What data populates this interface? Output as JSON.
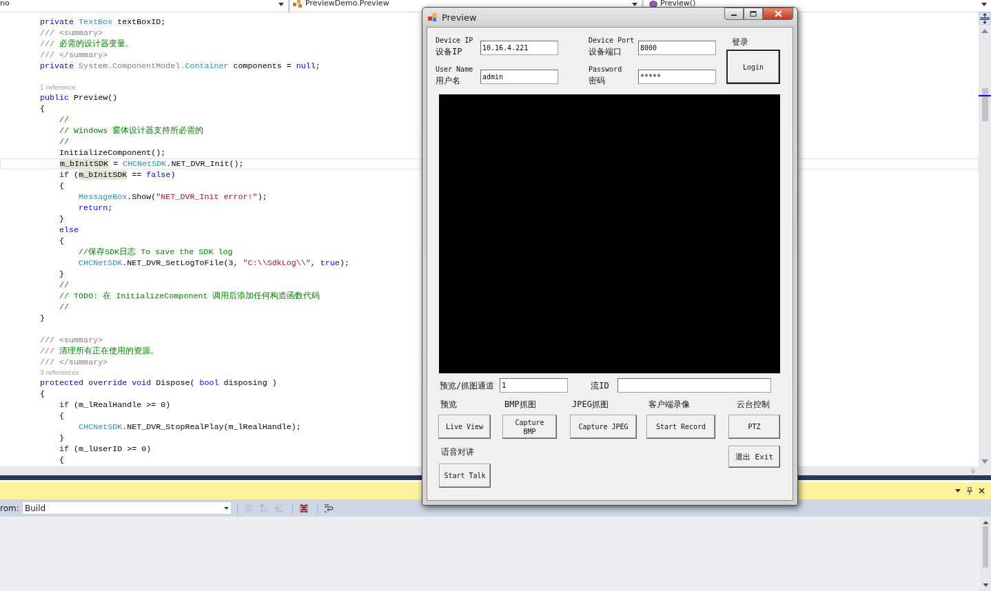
{
  "editor": {
    "nav": [
      "no",
      "PreviewDemo.Preview",
      "Preview()"
    ],
    "lines": [
      {
        "kind": "code",
        "current": false,
        "tokens": [
          {
            "kind": "keyword",
            "text": "private "
          },
          {
            "kind": "type",
            "text": "TextBox"
          },
          {
            "kind": "plain",
            "text": " textBoxID;"
          }
        ]
      },
      {
        "kind": "code",
        "current": false,
        "tokens": [
          {
            "kind": "doc",
            "text": "/// <summary>"
          }
        ]
      },
      {
        "kind": "code",
        "current": false,
        "tokens": [
          {
            "kind": "doc",
            "text": "/// "
          },
          {
            "kind": "comment",
            "text": "必需的设计器变量。"
          }
        ]
      },
      {
        "kind": "code",
        "current": false,
        "tokens": [
          {
            "kind": "doc",
            "text": "/// </summary>"
          }
        ]
      },
      {
        "kind": "code",
        "current": false,
        "tokens": [
          {
            "kind": "keyword",
            "text": "private "
          },
          {
            "kind": "doc",
            "text": "System.ComponentModel."
          },
          {
            "kind": "type",
            "text": "Container"
          },
          {
            "kind": "plain",
            "text": " components = "
          },
          {
            "kind": "keyword",
            "text": "null"
          },
          {
            "kind": "plain",
            "text": ";"
          }
        ]
      },
      {
        "kind": "blank"
      },
      {
        "kind": "lens",
        "text": "1 reference"
      },
      {
        "kind": "code",
        "current": false,
        "tokens": [
          {
            "kind": "keyword",
            "text": "public "
          },
          {
            "kind": "plain",
            "text": "Preview()"
          }
        ]
      },
      {
        "kind": "code",
        "current": false,
        "tokens": [
          {
            "kind": "plain",
            "text": "{"
          }
        ]
      },
      {
        "kind": "code",
        "current": false,
        "tokens": [
          {
            "kind": "comment",
            "text": "    //"
          }
        ]
      },
      {
        "kind": "code",
        "current": false,
        "tokens": [
          {
            "kind": "comment",
            "text": "    // Windows 窗体设计器支持所必需的"
          }
        ]
      },
      {
        "kind": "code",
        "current": false,
        "tokens": [
          {
            "kind": "comment",
            "text": "    //"
          }
        ]
      },
      {
        "kind": "code",
        "current": false,
        "tokens": [
          {
            "kind": "plain",
            "text": "    InitializeComponent();"
          }
        ]
      },
      {
        "kind": "code",
        "current": true,
        "tokens": [
          {
            "kind": "highlight",
            "text": "    m_bInitSDK"
          },
          {
            "kind": "plain",
            "text": " = "
          },
          {
            "kind": "type",
            "text": "CHCNetSDK"
          },
          {
            "kind": "plain",
            "text": ".NET_DVR_Init();"
          }
        ]
      },
      {
        "kind": "code",
        "current": false,
        "tokens": [
          {
            "kind": "keyword",
            "text": "    if"
          },
          {
            "kind": "plain",
            "text": " ("
          },
          {
            "kind": "highlight",
            "text": "m_bInitSDK"
          },
          {
            "kind": "plain",
            "text": " == "
          },
          {
            "kind": "keyword",
            "text": "false"
          },
          {
            "kind": "plain",
            "text": ")"
          }
        ]
      },
      {
        "kind": "code",
        "current": false,
        "tokens": [
          {
            "kind": "plain",
            "text": "    {"
          }
        ]
      },
      {
        "kind": "code",
        "current": false,
        "tokens": [
          {
            "kind": "type",
            "text": "        MessageBox"
          },
          {
            "kind": "plain",
            "text": ".Show("
          },
          {
            "kind": "string",
            "text": "\"NET_DVR_Init error!\""
          },
          {
            "kind": "plain",
            "text": ");"
          }
        ]
      },
      {
        "kind": "code",
        "current": false,
        "tokens": [
          {
            "kind": "keyword",
            "text": "        return"
          },
          {
            "kind": "plain",
            "text": ";"
          }
        ]
      },
      {
        "kind": "code",
        "current": false,
        "tokens": [
          {
            "kind": "plain",
            "text": "    }"
          }
        ]
      },
      {
        "kind": "code",
        "current": false,
        "tokens": [
          {
            "kind": "keyword",
            "text": "    else"
          }
        ]
      },
      {
        "kind": "code",
        "current": false,
        "tokens": [
          {
            "kind": "plain",
            "text": "    {"
          }
        ]
      },
      {
        "kind": "code",
        "current": false,
        "tokens": [
          {
            "kind": "comment",
            "text": "        //保存SDK日志 To save the SDK log"
          }
        ]
      },
      {
        "kind": "code",
        "current": false,
        "tokens": [
          {
            "kind": "type",
            "text": "        CHCNetSDK"
          },
          {
            "kind": "plain",
            "text": ".NET_DVR_SetLogToFile(3, "
          },
          {
            "kind": "string",
            "text": "\"C:\\\\SdkLog\\\\\""
          },
          {
            "kind": "plain",
            "text": ", "
          },
          {
            "kind": "keyword",
            "text": "true"
          },
          {
            "kind": "plain",
            "text": ");"
          }
        ]
      },
      {
        "kind": "code",
        "current": false,
        "tokens": [
          {
            "kind": "plain",
            "text": "    }"
          }
        ]
      },
      {
        "kind": "code",
        "current": false,
        "tokens": [
          {
            "kind": "comment",
            "text": "    //"
          }
        ]
      },
      {
        "kind": "code",
        "current": false,
        "tokens": [
          {
            "kind": "comment",
            "text": "    // TODO: 在 InitializeComponent 调用后添加任何构造函数代码"
          }
        ]
      },
      {
        "kind": "code",
        "current": false,
        "tokens": [
          {
            "kind": "comment",
            "text": "    //"
          }
        ]
      },
      {
        "kind": "code",
        "current": false,
        "tokens": [
          {
            "kind": "plain",
            "text": "}"
          }
        ]
      },
      {
        "kind": "blank"
      },
      {
        "kind": "code",
        "current": false,
        "tokens": [
          {
            "kind": "doc",
            "text": "/// <summary>"
          }
        ]
      },
      {
        "kind": "code",
        "current": false,
        "tokens": [
          {
            "kind": "doc",
            "text": "/// "
          },
          {
            "kind": "comment",
            "text": "清理所有正在使用的资源。"
          }
        ]
      },
      {
        "kind": "code",
        "current": false,
        "tokens": [
          {
            "kind": "doc",
            "text": "/// </summary>"
          }
        ]
      },
      {
        "kind": "lens",
        "text": "3 references"
      },
      {
        "kind": "code",
        "current": false,
        "tokens": [
          {
            "kind": "keyword",
            "text": "protected override void "
          },
          {
            "kind": "plain",
            "text": "Dispose( "
          },
          {
            "kind": "keyword",
            "text": "bool"
          },
          {
            "kind": "plain",
            "text": " disposing )"
          }
        ]
      },
      {
        "kind": "code",
        "current": false,
        "tokens": [
          {
            "kind": "plain",
            "text": "{"
          }
        ]
      },
      {
        "kind": "code",
        "current": false,
        "tokens": [
          {
            "kind": "keyword",
            "text": "    if"
          },
          {
            "kind": "plain",
            "text": " (m_lRealHandle >= 0)"
          }
        ]
      },
      {
        "kind": "code",
        "current": false,
        "tokens": [
          {
            "kind": "plain",
            "text": "    {"
          }
        ]
      },
      {
        "kind": "code",
        "current": false,
        "tokens": [
          {
            "kind": "type",
            "text": "        CHCNetSDK"
          },
          {
            "kind": "plain",
            "text": ".NET_DVR_StopRealPlay(m_lRealHandle);"
          }
        ]
      },
      {
        "kind": "code",
        "current": false,
        "tokens": [
          {
            "kind": "plain",
            "text": "    }"
          }
        ]
      },
      {
        "kind": "code",
        "current": false,
        "tokens": [
          {
            "kind": "keyword",
            "text": "    if"
          },
          {
            "kind": "plain",
            "text": " (m_lUserID >= 0)"
          }
        ]
      },
      {
        "kind": "code",
        "current": false,
        "tokens": [
          {
            "kind": "plain",
            "text": "    {"
          }
        ]
      }
    ]
  },
  "dialog": {
    "title": "Preview",
    "fields": [
      {
        "label_en": "Device IP",
        "label_zh": "设备IP",
        "value": "10.16.4.221"
      },
      {
        "label_en": "Device Port",
        "label_zh": "设备端口",
        "value": "8000"
      },
      {
        "label_en": "User Name",
        "label_zh": "用户名",
        "value": "admin"
      },
      {
        "label_en": "Password",
        "label_zh": "密码",
        "value": "*****"
      }
    ],
    "login_caption": "登录",
    "login_button": "Login",
    "channel_label": "预览/抓图通道",
    "channel_value": "1",
    "stream_label": "流ID",
    "actions": [
      {
        "caption": "预览",
        "button": "Live View"
      },
      {
        "caption": "BMP抓图",
        "button": "Capture BMP"
      },
      {
        "caption": "JPEG抓图",
        "button": "Capture JPEG"
      },
      {
        "caption": "客户端录像",
        "button": "Start Record"
      },
      {
        "caption": "云台控制",
        "button": "PTZ"
      }
    ],
    "talk_caption": "语音对讲",
    "talk_button": "Start Talk",
    "exit_button": "退出 Exit"
  },
  "output": {
    "from_label": "rom:",
    "source": "Build",
    "tools": [
      {
        "kind": "lines",
        "disabled": true
      },
      {
        "kind": "prev",
        "disabled": true
      },
      {
        "kind": "next",
        "disabled": true
      },
      {
        "kind": "clear",
        "disabled": false
      },
      {
        "kind": "wrap",
        "disabled": false
      }
    ]
  }
}
